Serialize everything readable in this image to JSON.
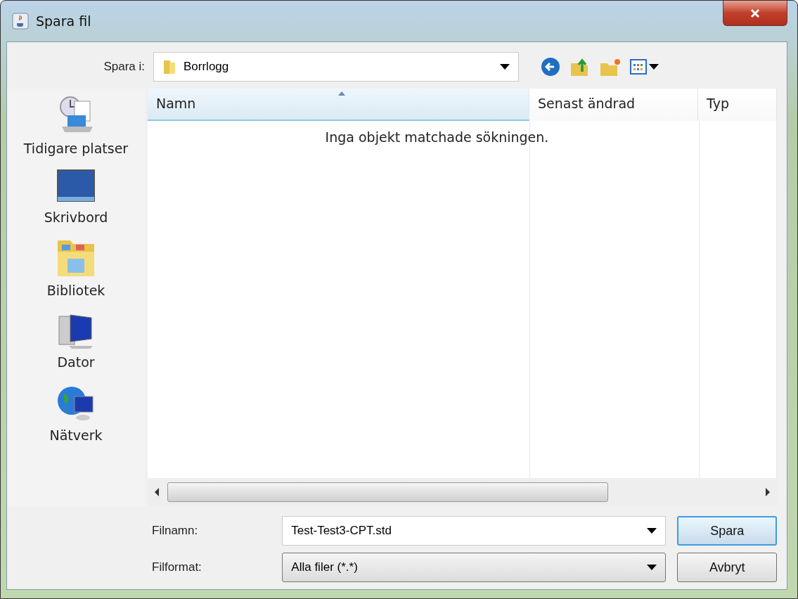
{
  "window": {
    "title": "Spara fil"
  },
  "location": {
    "label": "Spara i:",
    "value": "Borrlogg"
  },
  "places": [
    {
      "kind": "recent",
      "label": "Tidigare platser"
    },
    {
      "kind": "desktop",
      "label": "Skrivbord"
    },
    {
      "kind": "library",
      "label": "Bibliotek"
    },
    {
      "kind": "computer",
      "label": "Dator"
    },
    {
      "kind": "network",
      "label": "Nätverk"
    }
  ],
  "table": {
    "columns": [
      {
        "label": "Namn",
        "sorted": true
      },
      {
        "label": "Senast ändrad",
        "sorted": false
      },
      {
        "label": "Typ",
        "sorted": false
      }
    ],
    "empty_message": "Inga objekt matchade sökningen."
  },
  "filename": {
    "label": "Filnamn:",
    "value": "Test-Test3-CPT.std"
  },
  "filetype": {
    "label": "Filformat:",
    "value": "Alla filer (*.*)"
  },
  "buttons": [
    {
      "label": "Spara",
      "default": true
    },
    {
      "label": "Avbryt",
      "default": false
    }
  ]
}
